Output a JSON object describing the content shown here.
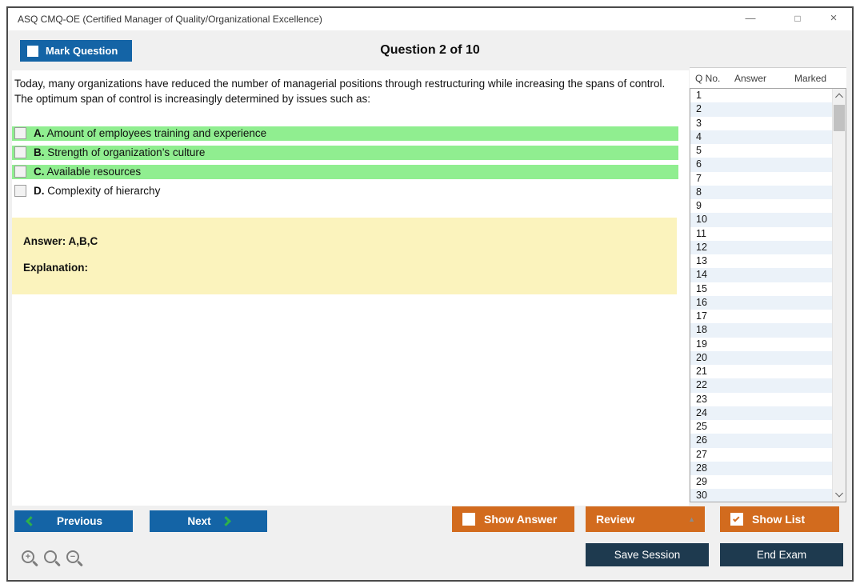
{
  "window": {
    "title": "ASQ CMQ-OE (Certified Manager of Quality/Organizational Excellence)"
  },
  "icons": {
    "minimize": "—",
    "maximize": "□",
    "close": "×",
    "review_caret": "▲",
    "zoom_in_sign": "+",
    "zoom_out_sign": "−"
  },
  "header": {
    "mark_question_label": "Mark Question",
    "question_counter": "Question 2 of 10"
  },
  "question": {
    "text": "Today, many organizations have reduced the number of managerial positions through restructuring while increasing the spans of control. The optimum span of control is increasingly determined by issues such as:",
    "options": [
      {
        "letter": "A.",
        "text": "Amount of employees training and experience",
        "highlighted": true,
        "checked": false
      },
      {
        "letter": "B.",
        "text": "Strength of organization’s culture",
        "highlighted": true,
        "checked": false
      },
      {
        "letter": "C.",
        "text": "Available resources",
        "highlighted": true,
        "checked": false
      },
      {
        "letter": "D.",
        "text": "Complexity of hierarchy",
        "highlighted": false,
        "checked": false
      }
    ],
    "answer_text": "Answer: A,B,C",
    "explanation_label": "Explanation:"
  },
  "sidebar": {
    "columns": [
      "Q No.",
      "Answer",
      "Marked"
    ],
    "rows": [
      "1",
      "2",
      "3",
      "4",
      "5",
      "6",
      "7",
      "8",
      "9",
      "10",
      "11",
      "12",
      "13",
      "14",
      "15",
      "16",
      "17",
      "18",
      "19",
      "20",
      "21",
      "22",
      "23",
      "24",
      "25",
      "26",
      "27",
      "28",
      "29",
      "30"
    ],
    "answers_empty": true,
    "marked_empty": true
  },
  "footer": {
    "previous_label": "Previous",
    "next_label": "Next",
    "show_answer_label": "Show Answer",
    "review_label": "Review",
    "show_list_label": "Show List",
    "save_session_label": "Save Session",
    "end_exam_label": "End Exam"
  },
  "states": {
    "mark_question_checked": false,
    "show_answer_checked": false,
    "show_list_checked": true
  },
  "colors": {
    "accent_blue": "#1464a6",
    "accent_orange": "#d26b1e",
    "dark_navy": "#1e3a4f",
    "highlight_green": "#90ee90",
    "answer_yellow": "#fbf3bd",
    "alt_row_blue": "#ebf2f9",
    "chevron_green": "#2eb14a"
  }
}
